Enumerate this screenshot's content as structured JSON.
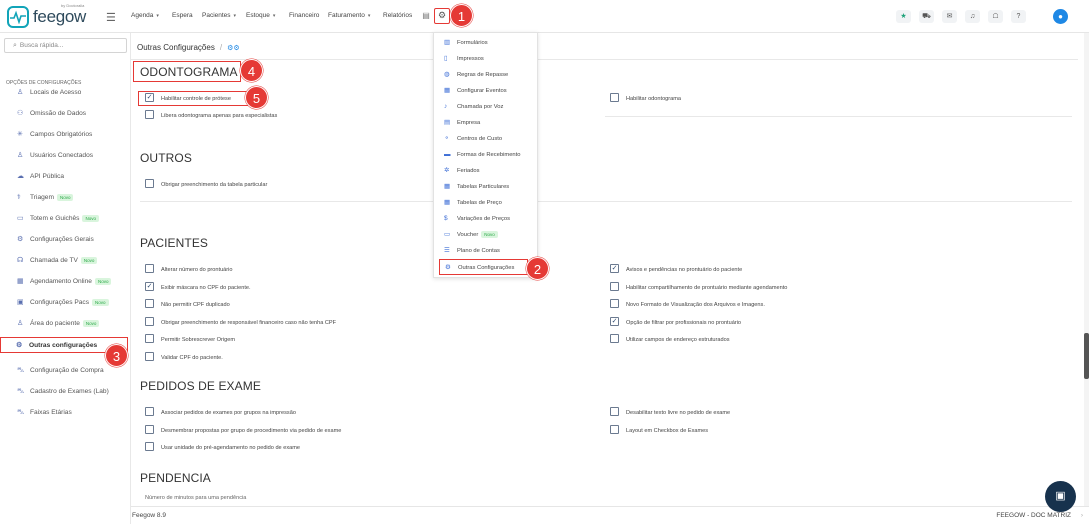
{
  "topbar": {
    "logo_text": "feegow",
    "logo_sub": "by Doctoralia",
    "nav": [
      {
        "label": "Agenda",
        "caret": true
      },
      {
        "label": "Espera",
        "caret": false
      },
      {
        "label": "Pacientes",
        "caret": true
      },
      {
        "label": "Estoque",
        "caret": true
      },
      {
        "label": "Financeiro",
        "caret": false
      },
      {
        "label": "Faturamento",
        "caret": true
      },
      {
        "label": "Relatórios",
        "caret": false
      }
    ]
  },
  "sidebar": {
    "search_placeholder": "Busca rápida...",
    "heading": "OPÇÕES DE CONFIGURAÇÕES",
    "new_badge": "Novo",
    "items": [
      {
        "label": "Locais de Acesso",
        "icon": "user-icon",
        "new": false
      },
      {
        "label": "Omissão de Dados",
        "icon": "users-icon",
        "new": false
      },
      {
        "label": "Campos Obrigatórios",
        "icon": "asterisk-icon",
        "new": false
      },
      {
        "label": "Usuários Conectados",
        "icon": "user-icon",
        "new": false
      },
      {
        "label": "API Pública",
        "icon": "cloud-icon",
        "new": false
      },
      {
        "label": "Triagem",
        "icon": "stethoscope-icon",
        "new": true
      },
      {
        "label": "Totem e Guichês",
        "icon": "laptop-icon",
        "new": true
      },
      {
        "label": "Configurações Gerais",
        "icon": "gears-icon",
        "new": false
      },
      {
        "label": "Chamada de TV",
        "icon": "megaphone-icon",
        "new": true
      },
      {
        "label": "Agendamento Online",
        "icon": "calendar-icon",
        "new": true
      },
      {
        "label": "Configurações Pacs",
        "icon": "monitor-icon",
        "new": true
      },
      {
        "label": "Área do paciente",
        "icon": "user-icon",
        "new": true
      },
      {
        "label": "Outras configurações",
        "icon": "gears-icon",
        "new": false,
        "active": true
      },
      {
        "label": "Configuração de Compra",
        "icon": "cart-icon",
        "new": false
      },
      {
        "label": "Cadastro de Exames (Lab)",
        "icon": "cart-icon",
        "new": false
      },
      {
        "label": "Faixas Etárias",
        "icon": "cart-icon",
        "new": false
      }
    ]
  },
  "main": {
    "breadcrumb_title": "Outras Configurações",
    "breadcrumb_sep": "/",
    "sections": {
      "odontograma": {
        "title": "ODONTOGRAMA",
        "left": [
          {
            "label": "Habilitar controle de prótese",
            "checked": true
          },
          {
            "label": "Libera odontograma apenas para especialistas",
            "checked": false
          }
        ],
        "right": [
          {
            "label": "Habilitar odontograma",
            "checked": false
          }
        ]
      },
      "outros": {
        "title": "OUTROS",
        "left": [
          {
            "label": "Obrigar preenchimento da tabela particular",
            "checked": false
          }
        ]
      },
      "pacientes": {
        "title": "PACIENTES",
        "left": [
          {
            "label": "Alterar número do prontuário",
            "checked": false
          },
          {
            "label": "Exibir máscara no CPF do paciente.",
            "checked": true
          },
          {
            "label": "Não permitir CPF duplicado",
            "checked": false
          },
          {
            "label": "Obrigar preenchimento de responsável financeiro caso não tenha CPF",
            "checked": false
          },
          {
            "label": "Permitir Sobrescrever Origem",
            "checked": false
          },
          {
            "label": "Validar CPF do paciente.",
            "checked": false
          }
        ],
        "right": [
          {
            "label": "Avisos e pendências no prontuário do paciente",
            "checked": true
          },
          {
            "label": "Habilitar compartilhamento de prontuário mediante agendamento",
            "checked": false
          },
          {
            "label": "Novo Formato de Visualização dos Arquivos e Imagens.",
            "checked": false
          },
          {
            "label": "Opção de filtrar por profissionais no prontuário",
            "checked": true
          },
          {
            "label": "Utilizar campos de endereço estruturados",
            "checked": false
          }
        ]
      },
      "pedidos": {
        "title": "PEDIDOS DE EXAME",
        "left": [
          {
            "label": "Associar pedidos de exames por grupos na impressão",
            "checked": false
          },
          {
            "label": "Desmembrar propostas por grupo de procedimento via pedido de exame",
            "checked": false
          },
          {
            "label": "Usar unidade do pré-agendamento no pedido de exame",
            "checked": false
          }
        ],
        "right": [
          {
            "label": "Desabilitar texto livre no pedido de exame",
            "checked": false
          },
          {
            "label": "Layout em Checkbox de Exames",
            "checked": false
          }
        ]
      },
      "pendencia": {
        "title": "PENDENCIA",
        "subtitle": "Número de minutos para uma pendência"
      }
    }
  },
  "dropdown": {
    "new_badge": "Novo",
    "items": [
      {
        "label": "Formulários",
        "icon": "chart-icon"
      },
      {
        "label": "Impressos",
        "icon": "file-icon"
      },
      {
        "label": "Regras de Repasse",
        "icon": "money-icon"
      },
      {
        "label": "Configurar Eventos",
        "icon": "calendar-icon"
      },
      {
        "label": "Chamada por Voz",
        "icon": "volume-icon"
      },
      {
        "label": "Empresa",
        "icon": "building-icon"
      },
      {
        "label": "Centros de Custo",
        "icon": "sitemap-icon"
      },
      {
        "label": "Formas de Recebimento",
        "icon": "card-icon"
      },
      {
        "label": "Feriados",
        "icon": "star-icon"
      },
      {
        "label": "Tabelas Particulares",
        "icon": "table-icon"
      },
      {
        "label": "Tabelas de Preço",
        "icon": "table-icon"
      },
      {
        "label": "Variações de Preços",
        "icon": "dollar-icon"
      },
      {
        "label": "Voucher",
        "icon": "ticket-icon",
        "new": true
      },
      {
        "label": "Plano de Contas",
        "icon": "list-icon"
      },
      {
        "label": "Outras Configurações",
        "icon": "gears-icon",
        "selected": true
      }
    ]
  },
  "annotations": [
    "1",
    "2",
    "3",
    "4",
    "5"
  ],
  "footer": {
    "version": "Feegow 8.9",
    "unit": "FEEGOW - DOC MATRIZ"
  },
  "colors": {
    "accent": "#1e88e5",
    "marker": "#e53935",
    "brand": "#11a4b8",
    "new_bg": "#d9f5dd",
    "new_fg": "#28a745"
  }
}
